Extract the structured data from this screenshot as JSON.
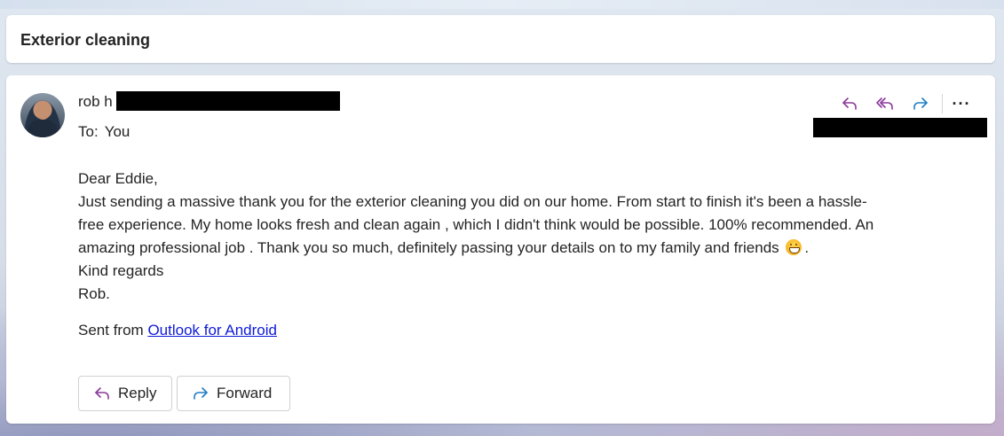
{
  "subject": {
    "title": "Exterior cleaning"
  },
  "message": {
    "sender_name": "rob h",
    "to_label": "To:",
    "to_value": "You",
    "body": {
      "greeting": "Dear Eddie,",
      "line1": "Just sending a massive thank you for the exterior cleaning you did on our home. From start to finish it's been a hassle-",
      "line2": "free experience. My home looks fresh and clean again , which I didn't think would be possible. 100% recommended. An",
      "line3": "amazing professional job . Thank you so much, definitely passing your details on to my family and friends",
      "line3_end": ".",
      "closing": "Kind regards",
      "name": "Rob."
    },
    "signature": {
      "prefix": "Sent from",
      "link_text": "Outlook for Android"
    },
    "actions": {
      "reply_icon": "reply-icon",
      "reply_all_icon": "reply-all-icon",
      "forward_icon": "forward-icon",
      "more_label": "···"
    },
    "buttons": {
      "reply_label": "Reply",
      "forward_label": "Forward"
    }
  },
  "colors": {
    "reply_accent": "#8a3a9c",
    "forward_accent": "#1f7ec6",
    "link": "#0f1ad6"
  }
}
